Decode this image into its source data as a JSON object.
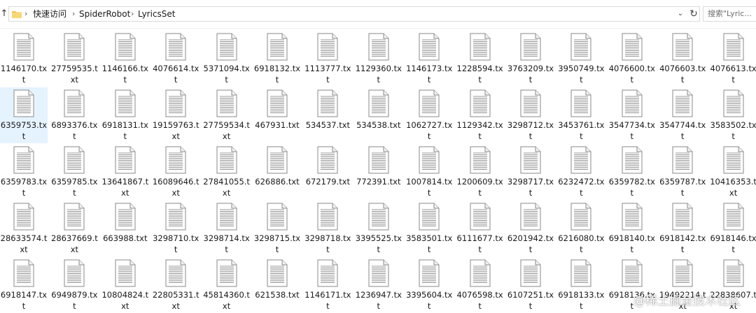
{
  "address_bar": {
    "path": [
      "快速访问",
      "SpiderRobot",
      "LyricsSet"
    ],
    "search_placeholder": "搜索\"Lyric...",
    "icons": {
      "up": "up-arrow-icon",
      "folder": "folder-icon",
      "separator": "chevron-right-icon",
      "dropdown": "chevron-down-icon",
      "refresh": "refresh-icon"
    }
  },
  "files": [
    [
      "1146170.txt",
      "27759535.txt",
      "1146166.txt",
      "4076614.txt",
      "5371094.txt",
      "6918132.txt",
      "1113777.txt",
      "1129360.txt",
      "1146173.txt",
      "1228594.txt",
      "3763209.txt",
      "3950749.txt",
      "4076600.txt",
      "4076603.txt",
      "4076613.txt"
    ],
    [
      "6359753.txt",
      "6893376.txt",
      "6918131.txt",
      "19159763.txt",
      "27759534.txt",
      "467931.txt",
      "534537.txt",
      "534538.txt",
      "1062727.txt",
      "1129342.txt",
      "3298712.txt",
      "3453761.txt",
      "3547734.txt",
      "3547744.txt",
      "3583502.txt"
    ],
    [
      "6359783.txt",
      "6359785.txt",
      "13641867.txt",
      "16089646.txt",
      "27841055.txt",
      "626886.txt",
      "672179.txt",
      "772391.txt",
      "1007814.txt",
      "1200609.txt",
      "3298717.txt",
      "6232472.txt",
      "6359782.txt",
      "6359787.txt",
      "10416353.txt"
    ],
    [
      "28633574.txt",
      "28637669.txt",
      "663988.txt",
      "3298710.txt",
      "3298714.txt",
      "3298715.txt",
      "3298718.txt",
      "3395525.txt",
      "3583501.txt",
      "6111677.txt",
      "6201942.txt",
      "6216080.txt",
      "6918140.txt",
      "6918142.txt",
      "6918146.txt"
    ],
    [
      "6918147.txt",
      "6949879.txt",
      "10804824.txt",
      "22805331.txt",
      "45814360.txt",
      "621538.txt",
      "1146171.txt",
      "1236947.txt",
      "3395604.txt",
      "4076598.txt",
      "6107251.txt",
      "6918133.txt",
      "6918136.txt",
      "19492214.txt",
      "22838607.txt"
    ]
  ],
  "selected": {
    "row": 1,
    "col": 0
  },
  "file_icon": "text-document-icon",
  "watermark": "@稀土掘金技术社区",
  "colors": {
    "selection": "#e5f3ff",
    "border": "#d9d9d9",
    "folder": "#f3c34b"
  }
}
